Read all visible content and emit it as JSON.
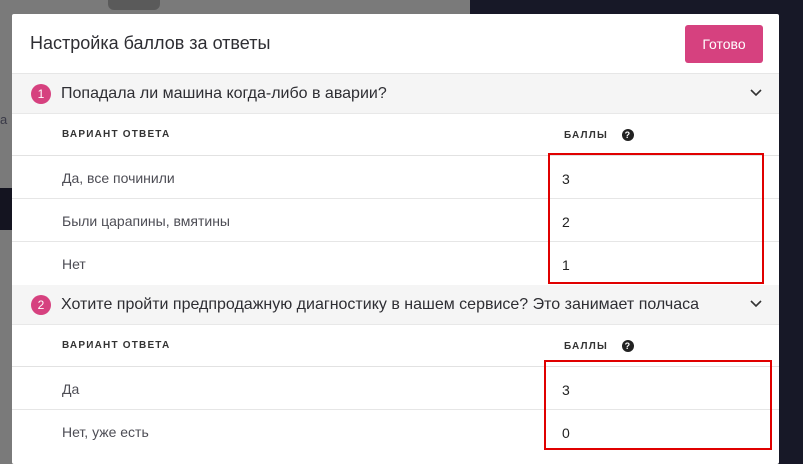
{
  "modal": {
    "title": "Настройка баллов за ответы",
    "done_label": "Готово"
  },
  "questions": [
    {
      "number": "1",
      "text": "Попадала ли машина когда-либо в аварии?",
      "col_answer": "ВАРИАНТ ОТВЕТА",
      "col_points": "БАЛЛЫ",
      "rows": [
        {
          "answer": "Да, все починили",
          "score": "3"
        },
        {
          "answer": "Были царапины, вмятины",
          "score": "2"
        },
        {
          "answer": "Нет",
          "score": "1"
        }
      ]
    },
    {
      "number": "2",
      "text": "Хотите пройти предпродажную диагностику в нашем сервисе? Это занимает полчаса",
      "col_answer": "ВАРИАНТ ОТВЕТА",
      "col_points": "БАЛЛЫ",
      "rows": [
        {
          "answer": "Да",
          "score": "3"
        },
        {
          "answer": "Нет, уже есть",
          "score": "0"
        }
      ]
    }
  ],
  "colors": {
    "accent": "#d6417f",
    "highlight": "#e00000",
    "backdrop_dark": "#171827"
  },
  "icons": {
    "collapse": "chevron-down-icon",
    "help": "question-circle-icon"
  },
  "background": {
    "fragment_text": "а"
  }
}
